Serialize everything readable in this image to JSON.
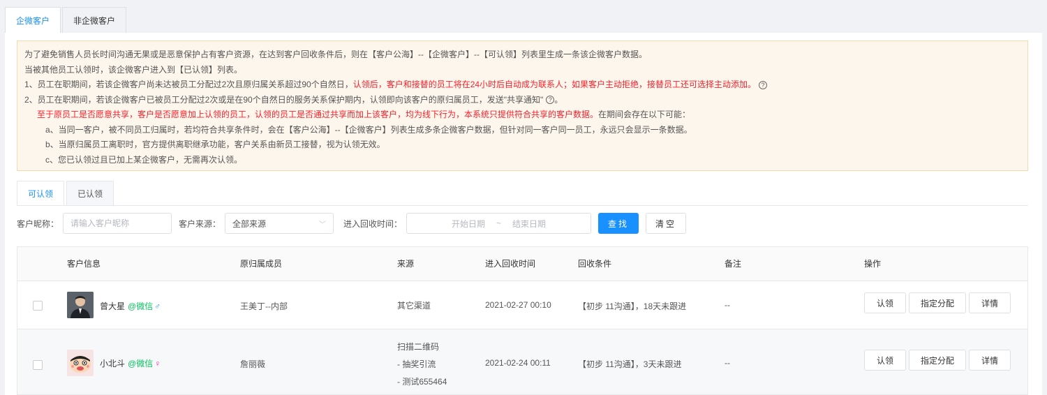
{
  "top_tabs": [
    "企微客户",
    "非企微客户"
  ],
  "notice": {
    "line1": "为了避免销售人员长时间沟通无果或是恶意保护占有客户资源，在达到客户回收条件后，则在【客户公海】--【企微客户】--【可认领】列表里生成一条该企微客户数据。",
    "line2": "当被其他员工认领时，该企微客户进入到【已认领】列表。",
    "line3a": "1、员工在职期间，若该企微客户尚未达被员工分配过2次且原归属关系超过90个自然日，",
    "line3b": "认领后，客户和接替的员工将在24小时后自动成为联系人；如果客户主动拒绝，接替员工还可选择主动添加。",
    "line4": "2、员工在职期间，若该企微客户已被员工分配过2次或是在90个自然日的服务关系保护期内，认领即向该客户的原归属员工，发送\"共享通知\"",
    "line4_end": "。",
    "line5a": "至于原员工是否愿意共享，客户是否愿意加上认领的员工，认领的员工是否通过共享而加上该客户，均为线下行为，本系统只提供符合共享的客户数据。",
    "line5b": "在期间会存在以下可能：",
    "line6": "a、当同一客户，被不同员工归属时，若均符合共享条件时，会在【客户公海】--【企微客户】列表生成多条企微客户数据，但针对同一客户同一员工，永远只会显示一条数据。",
    "line7": "b、当原归属员工离职时，官方提供离职继承功能，客户关系由新员工接替，视为认领无效。",
    "line8": "c、您已认领过且已加上某企微客户，无需再次认领。",
    "help": "?"
  },
  "sub_tabs": [
    "可认领",
    "已认领"
  ],
  "filters": {
    "nickname_label": "客户昵称：",
    "nickname_placeholder": "请输入客户昵称",
    "source_label": "客户来源：",
    "source_value": "全部来源",
    "time_label": "进入回收时间：",
    "start_placeholder": "开始日期",
    "sep": "~",
    "end_placeholder": "结束日期",
    "search": "查找",
    "clear": "清空"
  },
  "table": {
    "headers": [
      "客户信息",
      "原归属成员",
      "来源",
      "进入回收时间",
      "回收条件",
      "备注",
      "操作"
    ],
    "rows": [
      {
        "name": "曾大星",
        "wechat": "@微信",
        "gender_symbol": "♂",
        "owner": "王美丁--内部",
        "source": [
          "其它渠道"
        ],
        "time": "2021-02-27 00:10",
        "condition": "【初步 11沟通】，18天未跟进",
        "remark": "--"
      },
      {
        "name": "小北斗",
        "wechat": "@微信",
        "gender_symbol": "♀",
        "owner": "詹丽薇",
        "source": [
          "扫描二维码",
          "- 抽奖引流",
          "- 测试655464"
        ],
        "time": "2021-02-24 00:11",
        "condition": "【初步 11沟通】，3天未跟进",
        "remark": "--"
      }
    ],
    "actions": {
      "claim": "认领",
      "assign": "指定分配",
      "detail": "详情"
    }
  }
}
